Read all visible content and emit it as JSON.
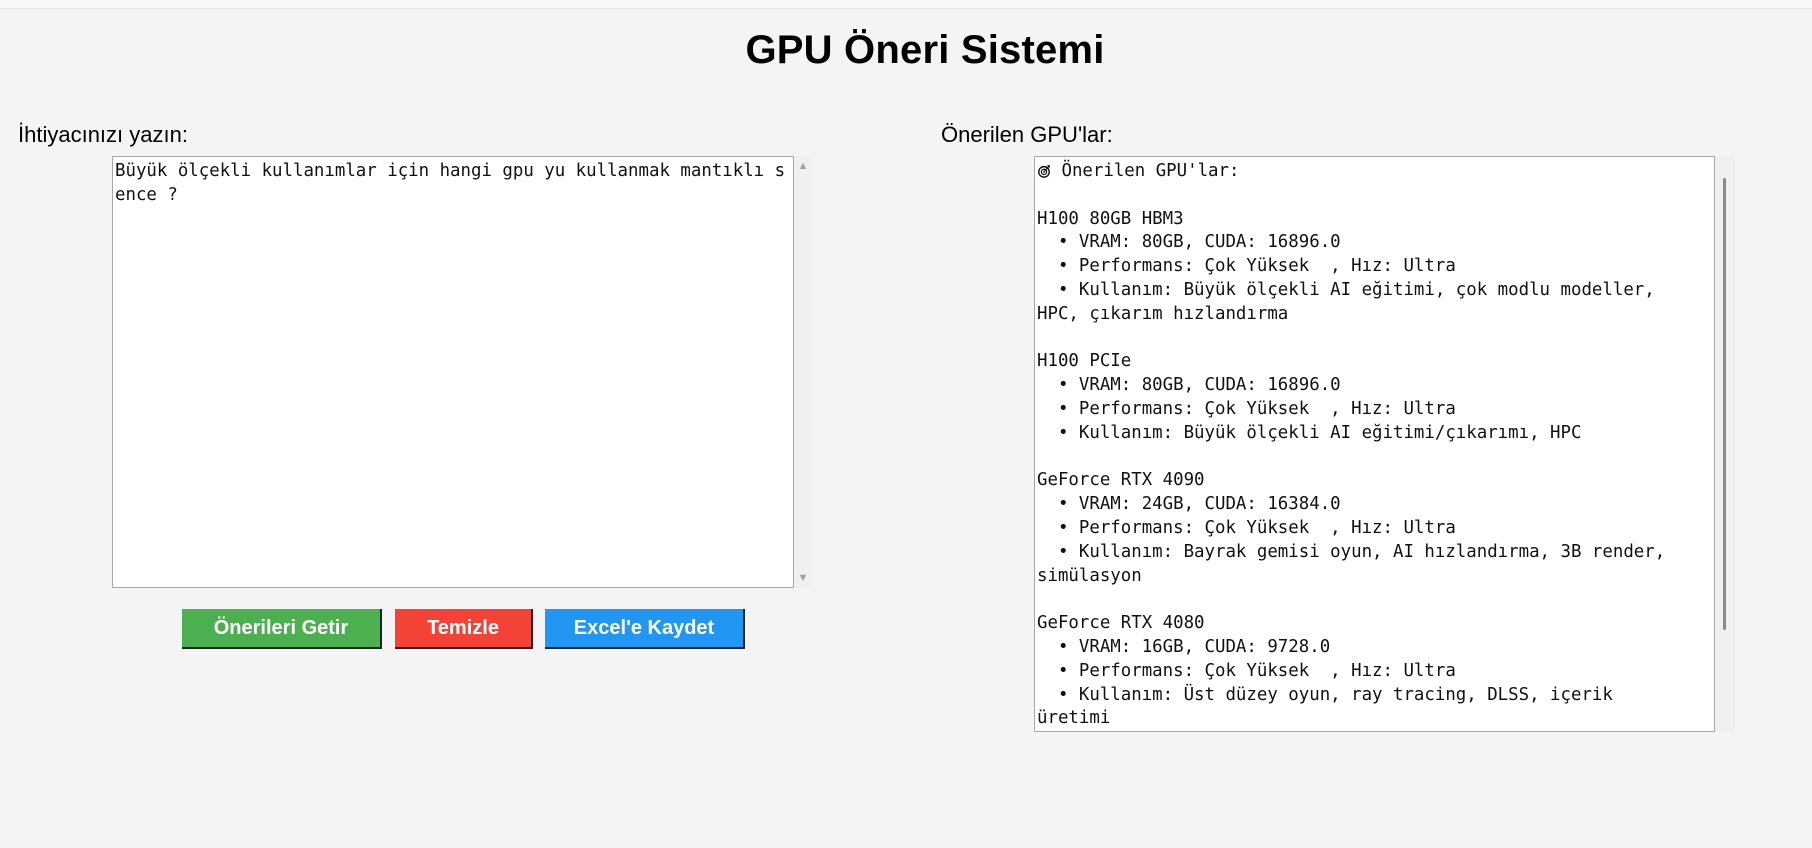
{
  "page": {
    "title": "GPU Öneri Sistemi"
  },
  "left_panel": {
    "label": "İhtiyacınızı yazın:",
    "input_value": "Büyük ölçekli kullanımlar için hangi gpu yu kullanmak mantıklı sence ?"
  },
  "right_panel": {
    "label": "Önerilen GPU'lar:",
    "output_lines": [
      {
        "icon": "target-icon",
        "text": " Önerilen GPU'lar:"
      },
      {
        "text": ""
      },
      {
        "text": "H100 80GB HBM3"
      },
      {
        "text": "  • VRAM: 80GB, CUDA: 16896.0"
      },
      {
        "text": "  • Performans: Çok Yüksek  , Hız: Ultra"
      },
      {
        "text": "  • Kullanım: Büyük ölçekli AI eğitimi, çok modlu modeller,"
      },
      {
        "text": "HPC, çıkarım hızlandırma"
      },
      {
        "text": ""
      },
      {
        "text": "H100 PCIe"
      },
      {
        "text": "  • VRAM: 80GB, CUDA: 16896.0"
      },
      {
        "text": "  • Performans: Çok Yüksek  , Hız: Ultra"
      },
      {
        "text": "  • Kullanım: Büyük ölçekli AI eğitimi/çıkarımı, HPC"
      },
      {
        "text": ""
      },
      {
        "text": "GeForce RTX 4090"
      },
      {
        "text": "  • VRAM: 24GB, CUDA: 16384.0"
      },
      {
        "text": "  • Performans: Çok Yüksek  , Hız: Ultra"
      },
      {
        "text": "  • Kullanım: Bayrak gemisi oyun, AI hızlandırma, 3B render,"
      },
      {
        "text": "simülasyon"
      },
      {
        "text": ""
      },
      {
        "text": "GeForce RTX 4080"
      },
      {
        "text": "  • VRAM: 16GB, CUDA: 9728.0"
      },
      {
        "text": "  • Performans: Çok Yüksek  , Hız: Ultra"
      },
      {
        "text": "  • Kullanım: Üst düzey oyun, ray tracing, DLSS, içerik"
      },
      {
        "text": "üretimi"
      }
    ]
  },
  "buttons": {
    "get_label": "Önerileri Getir",
    "clear_label": "Temizle",
    "excel_label": "Excel'e Kaydet"
  },
  "colors": {
    "get": "#4caf50",
    "clear": "#f44336",
    "excel": "#2196f3",
    "background": "#f4f4f4"
  }
}
